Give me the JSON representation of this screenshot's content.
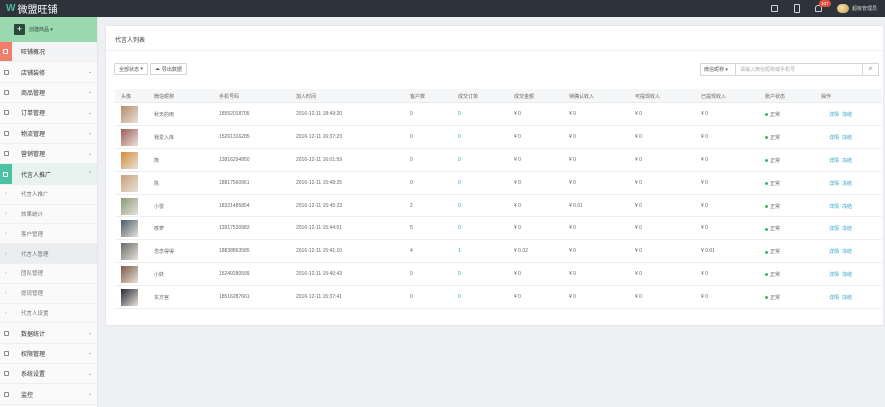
{
  "app": {
    "logo_text": "微盟旺铺",
    "logo_mark": "W"
  },
  "topbar": {
    "badge": "107",
    "user_name": "超级管理员"
  },
  "sidebar": {
    "create_label": "创建商品",
    "create_icon": "plus-icon",
    "items": [
      {
        "label": "旺铺概况",
        "icon": "home-icon",
        "chevron": ""
      },
      {
        "label": "店铺装修",
        "icon": "brush-icon",
        "chevron": "⌄"
      },
      {
        "label": "商品管理",
        "icon": "box-icon",
        "chevron": "⌄"
      },
      {
        "label": "订单管理",
        "icon": "order-icon",
        "chevron": "⌄"
      },
      {
        "label": "物流管理",
        "icon": "truck-icon",
        "chevron": "⌄"
      },
      {
        "label": "营销管理",
        "icon": "megaphone-icon",
        "chevron": "⌄"
      },
      {
        "label": "代言人推广",
        "icon": "heart-icon",
        "chevron": "⌃"
      }
    ],
    "sub_items": [
      {
        "label": "代言人推广"
      },
      {
        "label": "效果统计"
      },
      {
        "label": "客户管理"
      },
      {
        "label": "代言人管理"
      },
      {
        "label": "团队管理"
      },
      {
        "label": "提现管理"
      },
      {
        "label": "代言人设置"
      }
    ],
    "bottom_items": [
      {
        "label": "数据统计",
        "icon": "chart-icon",
        "chevron": "⌄"
      },
      {
        "label": "权限管理",
        "icon": "user-icon",
        "chevron": "⌄"
      },
      {
        "label": "系统设置",
        "icon": "gear-icon",
        "chevron": "⌄"
      },
      {
        "label": "监控",
        "icon": "gear-icon",
        "chevron": "⌄"
      }
    ]
  },
  "main": {
    "page_title": "代言人列表",
    "status_select": "全部状态",
    "export_label": "导出数据",
    "search_select": "微信昵称",
    "search_placeholder": "请输入微信昵称或手机号",
    "columns": [
      "头像",
      "微信昵称",
      "手机号码",
      "加入时间",
      "客户数",
      "成交订单",
      "成交金额",
      "待确认收入",
      "可提现收入",
      "已提现收入",
      "账户状态",
      "操作"
    ],
    "rows": [
      {
        "nick": "秋天的雨",
        "phone": "18552018705",
        "time": "2016-12-11 18:49:20",
        "customers": "0",
        "orders": "0",
        "amount": "¥ 0",
        "pending": "¥ 0",
        "withdrawable": "¥ 0",
        "withdrawn": "¥ 0",
        "status": "正常",
        "detail": "详情",
        "freeze": "冻结",
        "thumb_color": "#b58a6a"
      },
      {
        "nick": "我爱入库",
        "phone": "15261316285",
        "time": "2016-12-11 16:37:23",
        "customers": "0",
        "orders": "0",
        "amount": "¥ 0",
        "pending": "¥ 0",
        "withdrawable": "¥ 0",
        "withdrawn": "¥ 0",
        "status": "正常",
        "detail": "详情",
        "freeze": "冻结",
        "thumb_color": "#a05c58"
      },
      {
        "nick": "熊",
        "phone": "13816294950",
        "time": "2016-12-11 16:01:59",
        "customers": "0",
        "orders": "0",
        "amount": "¥ 0",
        "pending": "¥ 0",
        "withdrawable": "¥ 0",
        "withdrawn": "¥ 0",
        "status": "正常",
        "detail": "详情",
        "freeze": "冻结",
        "thumb_color": "#d48a3a"
      },
      {
        "nick": "陈",
        "phone": "18817560961",
        "time": "2016-12-11 15:48:25",
        "customers": "0",
        "orders": "0",
        "amount": "¥ 0",
        "pending": "¥ 0",
        "withdrawable": "¥ 0",
        "withdrawn": "¥ 0",
        "status": "正常",
        "detail": "详情",
        "freeze": "冻结",
        "thumb_color": "#c9a07a"
      },
      {
        "nick": "小雷",
        "phone": "18321485854",
        "time": "2016-12-11 15:45:23",
        "customers": "2",
        "orders": "0",
        "amount": "¥ 0",
        "pending": "¥ 0.01",
        "withdrawable": "¥ 0",
        "withdrawn": "¥ 0",
        "status": "正常",
        "detail": "详情",
        "freeze": "冻结",
        "thumb_color": "#8a9a7a"
      },
      {
        "nick": "哆萝",
        "phone": "13917530983",
        "time": "2016-12-11 15:44:01",
        "customers": "5",
        "orders": "0",
        "amount": "¥ 0",
        "pending": "¥ 0",
        "withdrawable": "¥ 0",
        "withdrawn": "¥ 0",
        "status": "正常",
        "detail": "详情",
        "freeze": "冻结",
        "thumb_color": "#4a5a6a"
      },
      {
        "nick": "念念得得",
        "phone": "18838863585",
        "time": "2016-12-11 15:41:10",
        "customers": "4",
        "orders": "1",
        "amount": "¥ 0.02",
        "pending": "¥ 0",
        "withdrawable": "¥ 0",
        "withdrawn": "¥ 0.01",
        "status": "正常",
        "detail": "详情",
        "freeze": "冻结",
        "thumb_color": "#6a6a6a"
      },
      {
        "nick": "小妖",
        "phone": "15249280599",
        "time": "2016-12-11 15:40:43",
        "customers": "0",
        "orders": "0",
        "amount": "¥ 0",
        "pending": "¥ 0",
        "withdrawable": "¥ 0",
        "withdrawn": "¥ 0",
        "status": "正常",
        "detail": "详情",
        "freeze": "冻结",
        "thumb_color": "#7a5a4a"
      },
      {
        "nick": "东方宫",
        "phone": "18516287661",
        "time": "2016-12-11 15:37:41",
        "customers": "0",
        "orders": "0",
        "amount": "¥ 0",
        "pending": "¥ 0",
        "withdrawable": "¥ 0",
        "withdrawn": "¥ 0",
        "status": "正常",
        "detail": "详情",
        "freeze": "冻结",
        "thumb_color": "#2a2a3a"
      }
    ]
  }
}
